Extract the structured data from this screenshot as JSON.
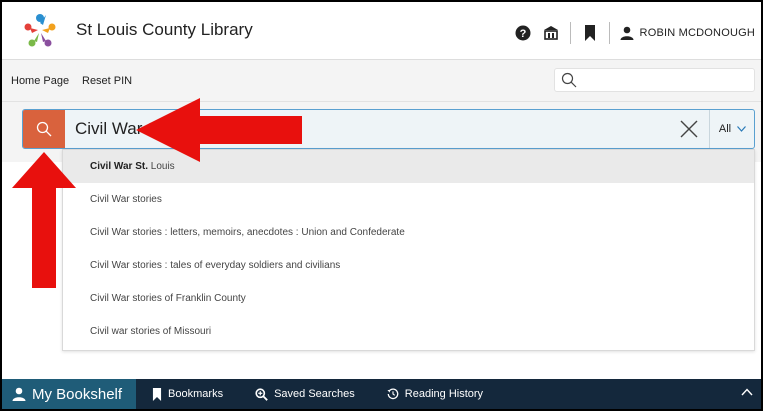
{
  "header": {
    "title": "St Louis County Library",
    "help_icon": "question-circle-icon",
    "library_icon": "library-building-icon",
    "bookmark_icon": "bookmark-icon",
    "user_icon": "user-icon",
    "user_name": "ROBIN MCDONOUGH"
  },
  "nav": {
    "links": [
      "Home Page",
      "Reset PIN"
    ],
    "mini_search_value": ""
  },
  "search": {
    "prefix": "Civil War St.",
    "scope": "All"
  },
  "suggestions": [
    {
      "bold": "Civil War St.",
      "rest": " Louis"
    },
    {
      "bold": "",
      "rest": "Civil War stories"
    },
    {
      "bold": "",
      "rest": "Civil War stories : letters, memoirs, anecdotes : Union and Confederate"
    },
    {
      "bold": "",
      "rest": "Civil War stories : tales of everyday soldiers and civilians"
    },
    {
      "bold": "",
      "rest": "Civil War stories of Franklin County"
    },
    {
      "bold": "",
      "rest": "Civil war stories of Missouri"
    }
  ],
  "bottombar": {
    "tabs": [
      "My Bookshelf",
      "Bookmarks",
      "Saved Searches",
      "Reading History"
    ]
  },
  "colors": {
    "search_button": "#d9623d",
    "bottom_bar": "#14283c",
    "active_tab": "#1f5c78",
    "annotation_arrow": "#e8100d"
  }
}
